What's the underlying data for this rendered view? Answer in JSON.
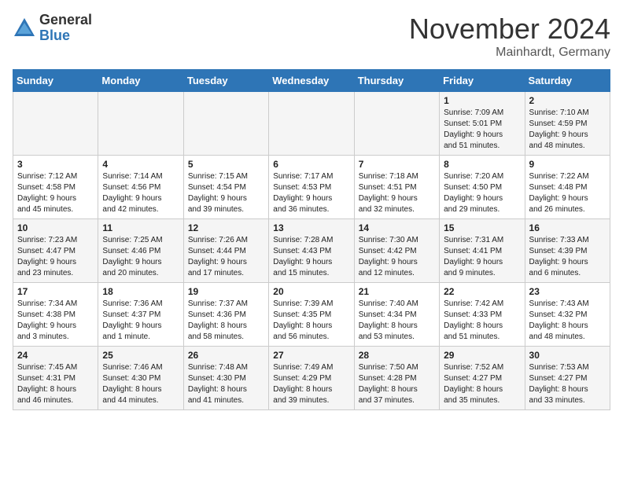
{
  "header": {
    "logo_general": "General",
    "logo_blue": "Blue",
    "month_title": "November 2024",
    "location": "Mainhardt, Germany"
  },
  "days_of_week": [
    "Sunday",
    "Monday",
    "Tuesday",
    "Wednesday",
    "Thursday",
    "Friday",
    "Saturday"
  ],
  "weeks": [
    [
      {
        "day": "",
        "info": ""
      },
      {
        "day": "",
        "info": ""
      },
      {
        "day": "",
        "info": ""
      },
      {
        "day": "",
        "info": ""
      },
      {
        "day": "",
        "info": ""
      },
      {
        "day": "1",
        "info": "Sunrise: 7:09 AM\nSunset: 5:01 PM\nDaylight: 9 hours\nand 51 minutes."
      },
      {
        "day": "2",
        "info": "Sunrise: 7:10 AM\nSunset: 4:59 PM\nDaylight: 9 hours\nand 48 minutes."
      }
    ],
    [
      {
        "day": "3",
        "info": "Sunrise: 7:12 AM\nSunset: 4:58 PM\nDaylight: 9 hours\nand 45 minutes."
      },
      {
        "day": "4",
        "info": "Sunrise: 7:14 AM\nSunset: 4:56 PM\nDaylight: 9 hours\nand 42 minutes."
      },
      {
        "day": "5",
        "info": "Sunrise: 7:15 AM\nSunset: 4:54 PM\nDaylight: 9 hours\nand 39 minutes."
      },
      {
        "day": "6",
        "info": "Sunrise: 7:17 AM\nSunset: 4:53 PM\nDaylight: 9 hours\nand 36 minutes."
      },
      {
        "day": "7",
        "info": "Sunrise: 7:18 AM\nSunset: 4:51 PM\nDaylight: 9 hours\nand 32 minutes."
      },
      {
        "day": "8",
        "info": "Sunrise: 7:20 AM\nSunset: 4:50 PM\nDaylight: 9 hours\nand 29 minutes."
      },
      {
        "day": "9",
        "info": "Sunrise: 7:22 AM\nSunset: 4:48 PM\nDaylight: 9 hours\nand 26 minutes."
      }
    ],
    [
      {
        "day": "10",
        "info": "Sunrise: 7:23 AM\nSunset: 4:47 PM\nDaylight: 9 hours\nand 23 minutes."
      },
      {
        "day": "11",
        "info": "Sunrise: 7:25 AM\nSunset: 4:46 PM\nDaylight: 9 hours\nand 20 minutes."
      },
      {
        "day": "12",
        "info": "Sunrise: 7:26 AM\nSunset: 4:44 PM\nDaylight: 9 hours\nand 17 minutes."
      },
      {
        "day": "13",
        "info": "Sunrise: 7:28 AM\nSunset: 4:43 PM\nDaylight: 9 hours\nand 15 minutes."
      },
      {
        "day": "14",
        "info": "Sunrise: 7:30 AM\nSunset: 4:42 PM\nDaylight: 9 hours\nand 12 minutes."
      },
      {
        "day": "15",
        "info": "Sunrise: 7:31 AM\nSunset: 4:41 PM\nDaylight: 9 hours\nand 9 minutes."
      },
      {
        "day": "16",
        "info": "Sunrise: 7:33 AM\nSunset: 4:39 PM\nDaylight: 9 hours\nand 6 minutes."
      }
    ],
    [
      {
        "day": "17",
        "info": "Sunrise: 7:34 AM\nSunset: 4:38 PM\nDaylight: 9 hours\nand 3 minutes."
      },
      {
        "day": "18",
        "info": "Sunrise: 7:36 AM\nSunset: 4:37 PM\nDaylight: 9 hours\nand 1 minute."
      },
      {
        "day": "19",
        "info": "Sunrise: 7:37 AM\nSunset: 4:36 PM\nDaylight: 8 hours\nand 58 minutes."
      },
      {
        "day": "20",
        "info": "Sunrise: 7:39 AM\nSunset: 4:35 PM\nDaylight: 8 hours\nand 56 minutes."
      },
      {
        "day": "21",
        "info": "Sunrise: 7:40 AM\nSunset: 4:34 PM\nDaylight: 8 hours\nand 53 minutes."
      },
      {
        "day": "22",
        "info": "Sunrise: 7:42 AM\nSunset: 4:33 PM\nDaylight: 8 hours\nand 51 minutes."
      },
      {
        "day": "23",
        "info": "Sunrise: 7:43 AM\nSunset: 4:32 PM\nDaylight: 8 hours\nand 48 minutes."
      }
    ],
    [
      {
        "day": "24",
        "info": "Sunrise: 7:45 AM\nSunset: 4:31 PM\nDaylight: 8 hours\nand 46 minutes."
      },
      {
        "day": "25",
        "info": "Sunrise: 7:46 AM\nSunset: 4:30 PM\nDaylight: 8 hours\nand 44 minutes."
      },
      {
        "day": "26",
        "info": "Sunrise: 7:48 AM\nSunset: 4:30 PM\nDaylight: 8 hours\nand 41 minutes."
      },
      {
        "day": "27",
        "info": "Sunrise: 7:49 AM\nSunset: 4:29 PM\nDaylight: 8 hours\nand 39 minutes."
      },
      {
        "day": "28",
        "info": "Sunrise: 7:50 AM\nSunset: 4:28 PM\nDaylight: 8 hours\nand 37 minutes."
      },
      {
        "day": "29",
        "info": "Sunrise: 7:52 AM\nSunset: 4:27 PM\nDaylight: 8 hours\nand 35 minutes."
      },
      {
        "day": "30",
        "info": "Sunrise: 7:53 AM\nSunset: 4:27 PM\nDaylight: 8 hours\nand 33 minutes."
      }
    ]
  ]
}
